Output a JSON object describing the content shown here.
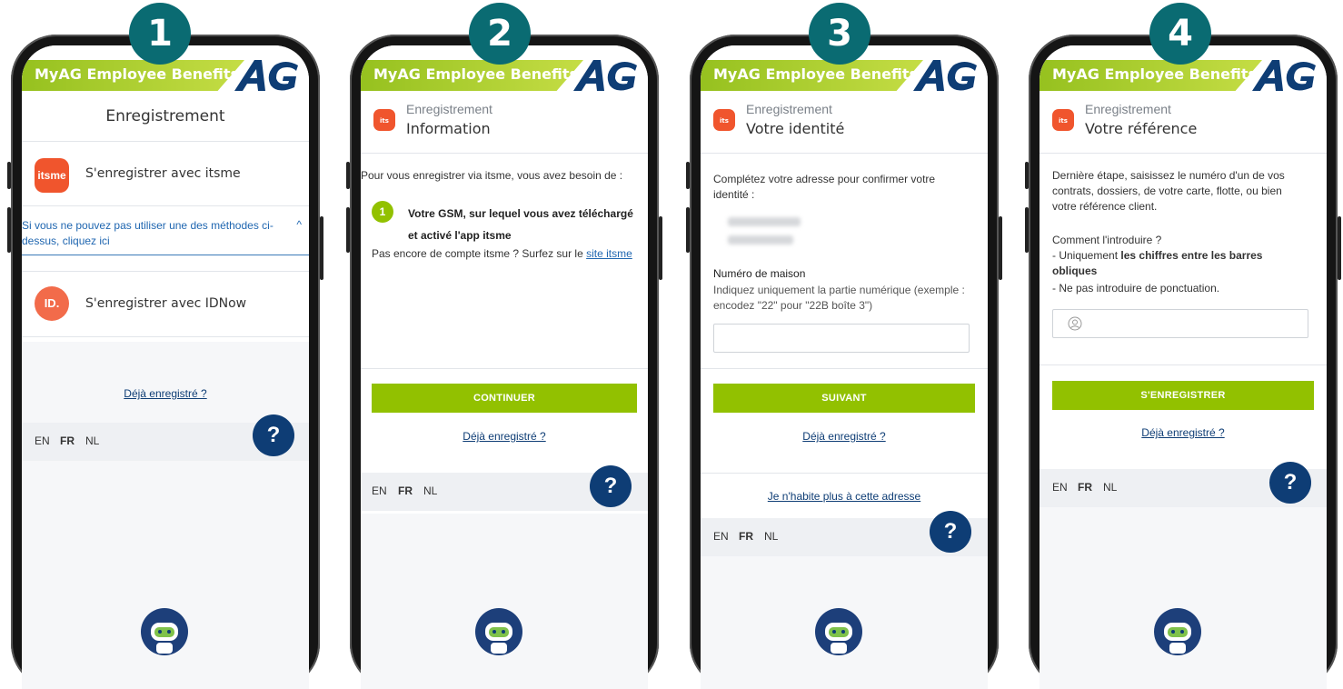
{
  "header": {
    "title": "MyAG Employee Benefits"
  },
  "phones": {
    "p1": {
      "step": "1",
      "heading": "Enregistrement",
      "itsme_logo": "itsme",
      "itsme_label": "S'enregistrer avec itsme",
      "alt_text": "Si vous ne pouvez pas utiliser une des méthodes ci-dessus, cliquez ici",
      "idnow_logo": "ID.",
      "idnow_label": "S'enregistrer avec IDNow",
      "already": "Déjà enregistré ?",
      "help": "?"
    },
    "p2": {
      "step": "2",
      "sub": "Enregistrement",
      "main": "Information",
      "intro": "Pour vous enregistrer via itsme, vous avez besoin de :",
      "num": "1",
      "item": "Votre GSM, sur lequel vous avez téléchargé et activé l'app itsme",
      "account_q": "Pas encore de compte itsme ? Surfez sur le",
      "account_link": "site itsme",
      "button": "CONTINUER",
      "already": "Déjà enregistré ?",
      "help": "?"
    },
    "p3": {
      "step": "3",
      "sub": "Enregistrement",
      "main": "Votre identité",
      "intro": "Complétez votre adresse pour confirmer votre identité :",
      "house_label": "Numéro de maison",
      "house_hint": "Indiquez uniquement la partie numérique (exemple : encodez \"22\" pour \"22B boîte 3\")",
      "button": "SUIVANT",
      "already": "Déjà enregistré ?",
      "moved": "Je n'habite plus à cette adresse",
      "help": "?"
    },
    "p4": {
      "step": "4",
      "sub": "Enregistrement",
      "main": "Votre référence",
      "intro": "Dernière étape, saisissez le numéro d'un de vos contrats, dossiers, de votre carte, flotte, ou bien votre référence client.",
      "how": "Comment l'introduire ?",
      "rule1_prefix": "- Uniquement",
      "rule1_bold": "les chiffres entre les barres obliques",
      "rule2": "- Ne pas introduire de ponctuation.",
      "button": "S'ENREGISTRER",
      "already": "Déjà enregistré ?",
      "help": "?"
    }
  },
  "langs": {
    "en": "EN",
    "fr": "FR",
    "nl": "NL"
  },
  "colors": {
    "green": "#92c100",
    "navy": "#0e3d75",
    "teal": "#0a6b72",
    "itsme": "#f0552d",
    "idnow": "#f26b4a"
  }
}
